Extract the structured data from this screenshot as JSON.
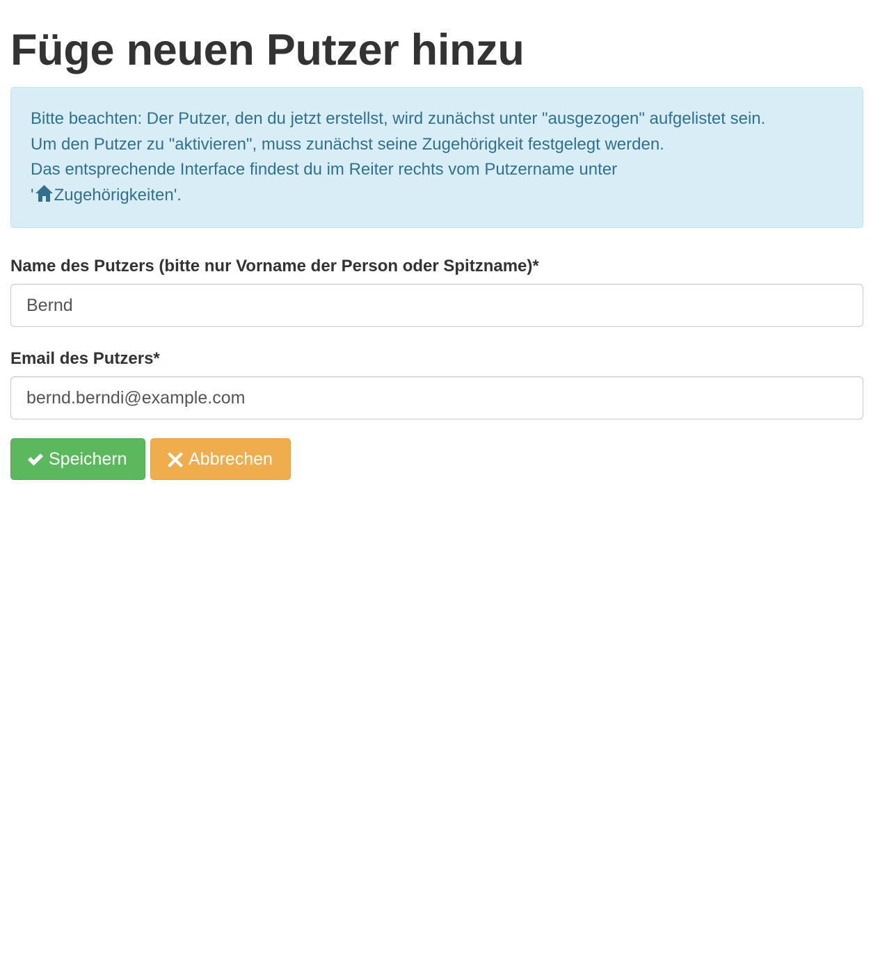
{
  "page": {
    "title": "Füge neuen Putzer hinzu"
  },
  "alert": {
    "line1": "Bitte beachten: Der Putzer, den du jetzt erstellst, wird zunächst unter \"ausgezogen\" aufgelistet sein.",
    "line2": "Um den Putzer zu \"aktivieren\", muss zunächst seine Zugehörigkeit festgelegt werden.",
    "line3": "Das entsprechende Interface findest du im Reiter rechts vom Putzername unter",
    "line4_prefix": "'",
    "line4_link": "Zugehörigkeiten",
    "line4_suffix": "'.",
    "icon": "home-icon"
  },
  "form": {
    "name_label": "Name des Putzers (bitte nur Vorname der Person oder Spitzname)*",
    "name_value": "Bernd",
    "email_label": "Email des Putzers*",
    "email_value": "bernd.berndi@example.com"
  },
  "buttons": {
    "save_label": "Speichern",
    "save_icon": "checkmark-icon",
    "cancel_label": "Abbrechen",
    "cancel_icon": "cross-icon"
  },
  "colors": {
    "alert_bg": "#d9edf7",
    "alert_text": "#31708f",
    "success": "#5cb85c",
    "warning": "#f0ad4e"
  }
}
